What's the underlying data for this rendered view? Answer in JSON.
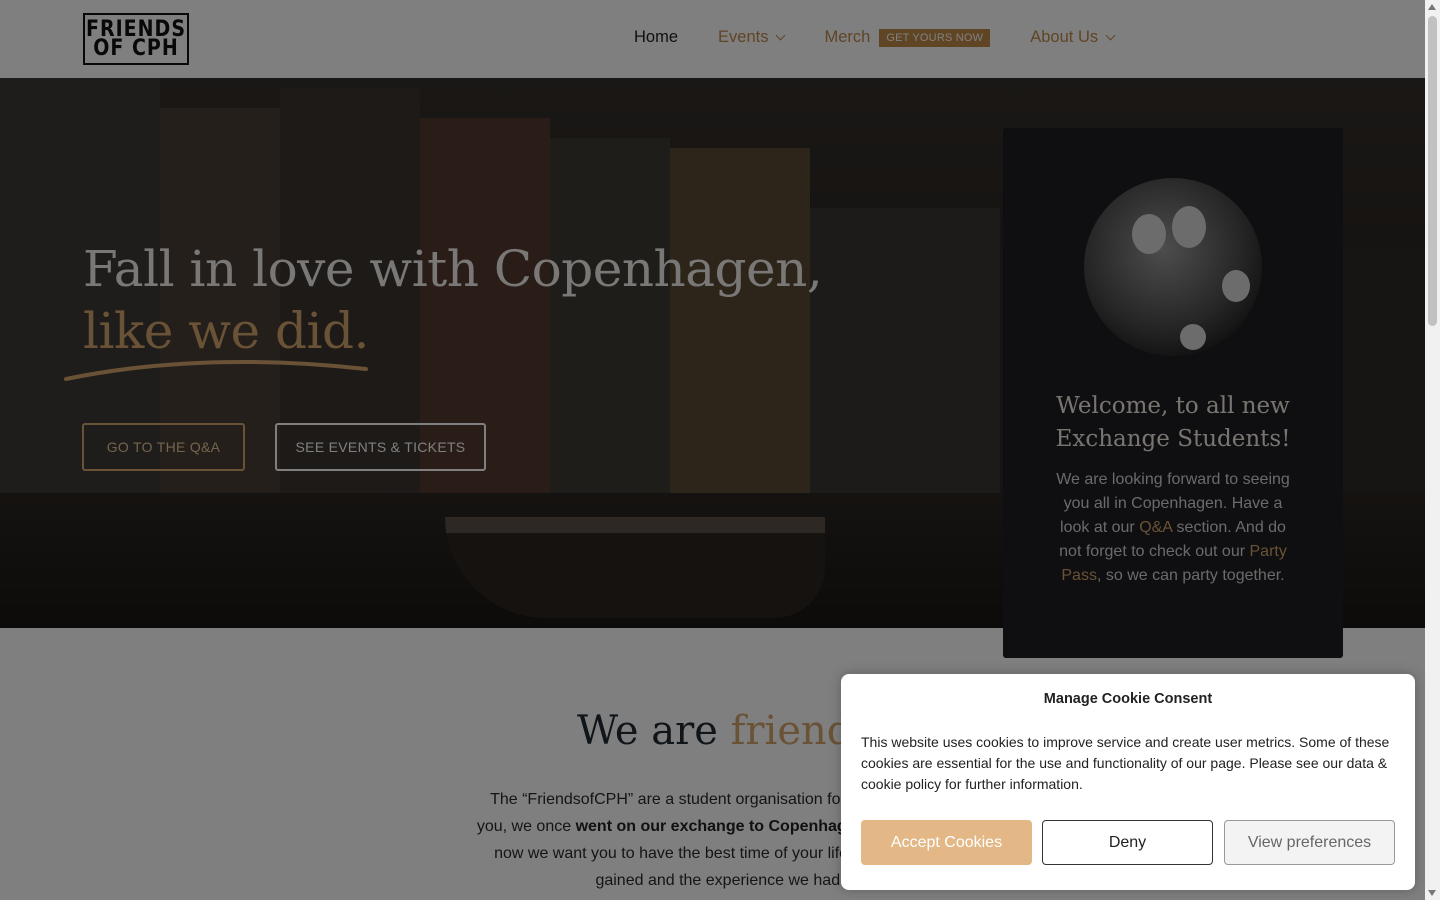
{
  "header": {
    "logo_line1": "FRIENDS",
    "logo_line2": "OF CPH",
    "nav": {
      "home": "Home",
      "events": "Events",
      "merch": "Merch",
      "merch_badge": "GET YOURS NOW",
      "about": "About Us"
    }
  },
  "hero": {
    "title_line1": "Fall in love with Copenhagen,",
    "title_line2": "like we did.",
    "btn_qa": "GO TO THE Q&A",
    "btn_events": "SEE EVENTS & TICKETS"
  },
  "welcome_card": {
    "title": "Welcome, to all new Exchange Students!",
    "text_1": "We are looking forward to seeing you all in Copenhagen. Have a look at our ",
    "link_qa": "Q&A",
    "text_2": " section. And do not forget to check out our ",
    "link_party": "Party Pass",
    "text_3": ", so we can party together."
  },
  "about": {
    "title_part1": "We are ",
    "title_accent": "friends",
    "text_1": "The “FriendsofCPH” are a student organisation founded by stude",
    "text_2": "you, we once ",
    "text_bold": "went on our exchange to Copenhagen and fell in lo",
    "text_3": "now we want you to have the best time of your life by giving bac",
    "text_4": "gained and the experience we had."
  },
  "cookie": {
    "title": "Manage Cookie Consent",
    "text": "This website uses cookies to improve service and create user metrics. Some of these cookies are essential for the use and functionality of our page. Please see our data & cookie policy for further information.",
    "accept": "Accept Cookies",
    "deny": "Deny",
    "preferences": "View preferences"
  },
  "colors": {
    "accent": "#d3a56a",
    "accept_button": "#e3b886",
    "card_bg": "#1f1f22"
  }
}
